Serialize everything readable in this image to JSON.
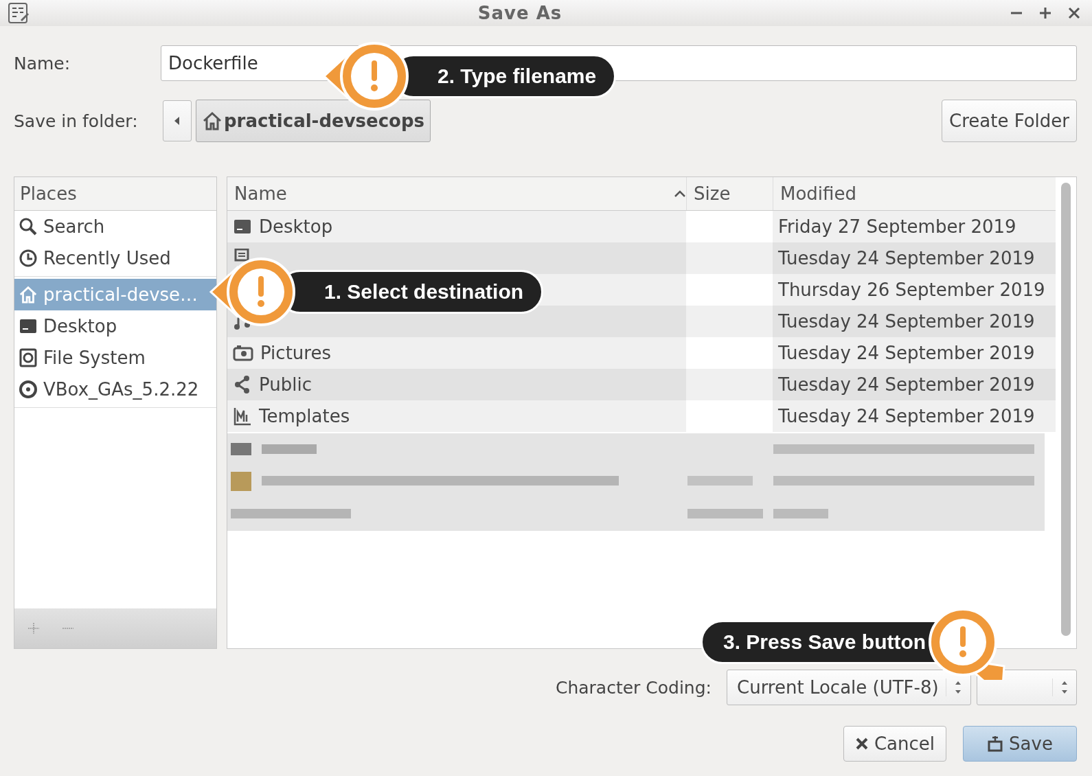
{
  "window": {
    "title": "Save As"
  },
  "name_field": {
    "label": "Name:",
    "value": "Dockerfile"
  },
  "folder": {
    "label": "Save in folder:",
    "path": "practical-devsecops"
  },
  "create_folder": "Create Folder",
  "places": {
    "header": "Places",
    "items": [
      {
        "kind": "search",
        "label": "Search",
        "selected": false
      },
      {
        "kind": "recent",
        "label": "Recently Used",
        "selected": false
      },
      {
        "kind": "home",
        "label": "practical-devse…",
        "selected": true
      },
      {
        "kind": "desktop",
        "label": "Desktop",
        "selected": false
      },
      {
        "kind": "drive",
        "label": "File System",
        "selected": false
      },
      {
        "kind": "disc",
        "label": "VBox_GAs_5.2.22",
        "selected": false
      }
    ]
  },
  "files": {
    "columns": [
      "Name",
      "Size",
      "Modified"
    ],
    "rows": [
      {
        "kind": "desktop",
        "name": "Desktop",
        "modified": "Friday 27 September 2019"
      },
      {
        "kind": "document",
        "modified": "Tuesday 24 September 2019"
      },
      {
        "kind": "none",
        "modified": "Thursday 26 September 2019"
      },
      {
        "kind": "music",
        "modified": "Tuesday 24 September 2019"
      },
      {
        "kind": "pictures",
        "name": "Pictures",
        "modified": "Tuesday 24 September 2019"
      },
      {
        "kind": "share",
        "name": "Public",
        "modified": "Tuesday 24 September 2019"
      },
      {
        "kind": "templates",
        "name": "Templates",
        "modified": "Tuesday 24 September 2019"
      }
    ]
  },
  "coding": {
    "label": "Character Coding:",
    "value": "Current Locale (UTF-8)"
  },
  "buttons": [
    {
      "kind": "cancel",
      "label": "Cancel"
    },
    {
      "kind": "save",
      "label": "Save"
    }
  ],
  "callouts": [
    {
      "label": "2. Type filename"
    },
    {
      "label": "1. Select destination"
    },
    {
      "label": "3. Press Save button"
    }
  ]
}
